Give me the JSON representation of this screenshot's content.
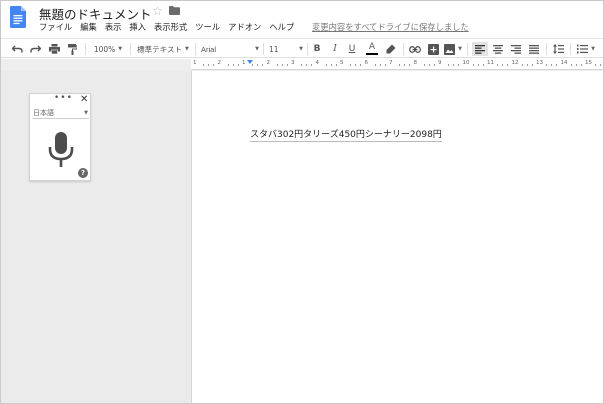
{
  "header": {
    "doc_title": "無題のドキュメント",
    "save_status": "変更内容をすべてドライブに保存しました"
  },
  "menu": {
    "items": [
      "ファイル",
      "編集",
      "表示",
      "挿入",
      "表示形式",
      "ツール",
      "アドオン",
      "ヘルプ"
    ]
  },
  "toolbar": {
    "zoom": "100%",
    "style": "標準テキスト",
    "font": "Arial",
    "font_size": "11",
    "bold": "B",
    "italic": "I",
    "underline": "U",
    "text_color_letter": "A"
  },
  "ruler": {
    "labels": [
      "1",
      "2",
      "1",
      "2",
      "3",
      "4",
      "5",
      "6",
      "7",
      "8",
      "9",
      "10",
      "11",
      "12",
      "13",
      "14",
      "15"
    ]
  },
  "voice_panel": {
    "dots": "•••",
    "close": "✕",
    "language": "日本語",
    "help": "?"
  },
  "document": {
    "text": "スタバ302円タリーズ450円シーナリー2098円"
  },
  "colors": {
    "docs_blue": "#4285f4",
    "mic_gray": "#4d4d4d",
    "workspace_bg": "#ebebeb"
  }
}
